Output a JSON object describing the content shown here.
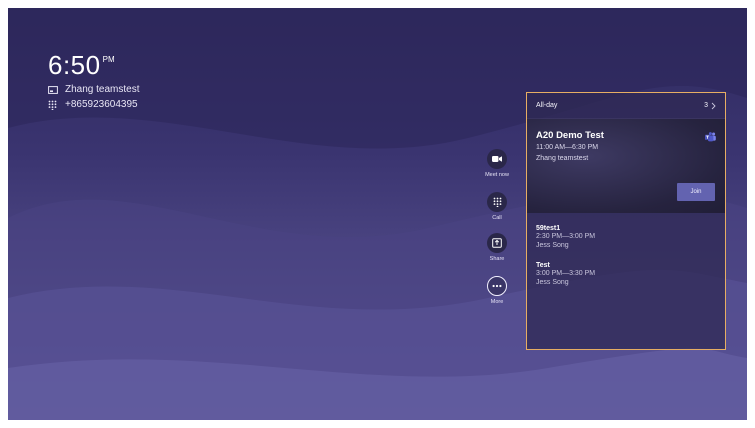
{
  "clock": {
    "time": "6:50",
    "ampm": "PM"
  },
  "device": {
    "name": "Zhang teamstest",
    "phone": "+865923604395"
  },
  "actions": [
    {
      "label": "Meet now",
      "icon": "video-camera-icon"
    },
    {
      "label": "Call",
      "icon": "dialpad-icon"
    },
    {
      "label": "Share",
      "icon": "share-screen-icon"
    },
    {
      "label": "More",
      "icon": "more-icon"
    }
  ],
  "calendar": {
    "header_label": "All-day",
    "count": "3",
    "featured": {
      "title": "A20 Demo Test",
      "time": "11:00 AM—6:30 PM",
      "organizer": "Zhang teamstest",
      "join_label": "Join",
      "icon": "teams-logo-icon"
    },
    "meetings": [
      {
        "title": "59test1",
        "time": "2:30 PM—3:00 PM",
        "organizer": "Jess Song"
      },
      {
        "title": "Test",
        "time": "3:00 PM—3:30 PM",
        "organizer": "Jess Song"
      }
    ]
  },
  "colors": {
    "accent_border": "#e7ae63",
    "join_button": "#6363b0",
    "background": "#3a3470"
  }
}
